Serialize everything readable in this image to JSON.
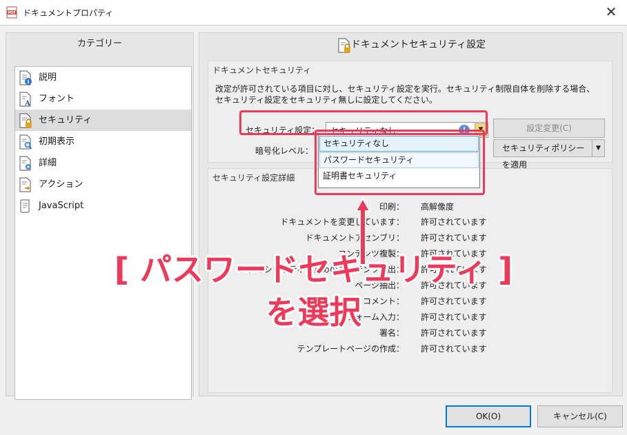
{
  "window": {
    "title": "ドキュメントプロパティ",
    "close": "✕"
  },
  "left": {
    "header": "カテゴリー",
    "items": [
      {
        "label": "説明",
        "icon": "document-info-icon"
      },
      {
        "label": "フォント",
        "icon": "document-font-icon"
      },
      {
        "label": "セキュリティ",
        "icon": "document-lock-icon",
        "selected": true
      },
      {
        "label": "初期表示",
        "icon": "document-search-icon"
      },
      {
        "label": "詳細",
        "icon": "document-gear-icon"
      },
      {
        "label": "アクション",
        "icon": "document-arrow-icon"
      },
      {
        "label": "JavaScript",
        "icon": "scroll-icon"
      }
    ]
  },
  "right": {
    "header": "ドキュメントセキュリティ設定",
    "security_group": {
      "title": "ドキュメントセキュリティ",
      "description": "改定が許可されている項目に対し、セキュリティ設定を実行。セキュリティ制限自体を削除する場合、セキュリティ設定をセキュリティ無しに設定してください。",
      "security_label": "セキュリティ設定：",
      "security_value": "セキュリティなし",
      "change_button": "設定変更(C)",
      "encryption_label": "暗号化レベル：",
      "apply_policy_button": "セキュリティポリシーを適用",
      "dropdown_options": [
        "セキュリティなし",
        "パスワードセキュリティ",
        "証明書セキュリティ"
      ]
    },
    "detail_group": {
      "title": "セキュリティ設定詳細",
      "rows": [
        {
          "label": "印刷：",
          "value": "高解像度"
        },
        {
          "label": "ドキュメントを変更しています：",
          "value": "許可されています"
        },
        {
          "label": "ドキュメントアセンブリ：",
          "value": "許可されています"
        },
        {
          "label": "コンテンツ複製：",
          "value": "許可されています"
        },
        {
          "label": "アクセシビリティのためのコンテンツ抽出：",
          "value": "許可されています"
        },
        {
          "label": "ページ抽出：",
          "value": "許可されています"
        },
        {
          "label": "コメント：",
          "value": "許可されています"
        },
        {
          "label": "フォーム入力：",
          "value": "許可されています"
        },
        {
          "label": "署名：",
          "value": "許可されています"
        },
        {
          "label": "テンプレートページの作成：",
          "value": "許可されています"
        }
      ]
    }
  },
  "annotation": {
    "line1": "[ パスワードセキュリティ ]",
    "line2": "を選択",
    "color": "#ee3a5a"
  },
  "footer": {
    "ok": "OK(O)",
    "cancel": "キャンセル(C)"
  }
}
